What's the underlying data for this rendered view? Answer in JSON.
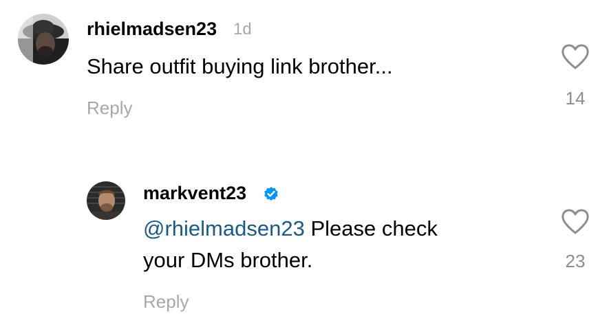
{
  "comments": [
    {
      "username": "rhielmadsen23",
      "timestamp": "1d",
      "text": "Share outfit buying link brother...",
      "reply_label": "Reply",
      "like_count": "14",
      "avatar_icon": "avatar-photo"
    }
  ],
  "replies": [
    {
      "username": "markvent23",
      "verified": true,
      "mention": "@rhielmadsen23",
      "text_line1_rest": " Please check",
      "text_line2": "your DMs brother.",
      "reply_label": "Reply",
      "like_count": "23",
      "avatar_icon": "avatar-photo"
    }
  ],
  "icons": {
    "like": "heart-outline-icon",
    "verified": "verified-badge-icon"
  },
  "colors": {
    "mention": "#1b5a85",
    "verified_blue": "#0095f6",
    "muted": "#a8a8a8"
  }
}
